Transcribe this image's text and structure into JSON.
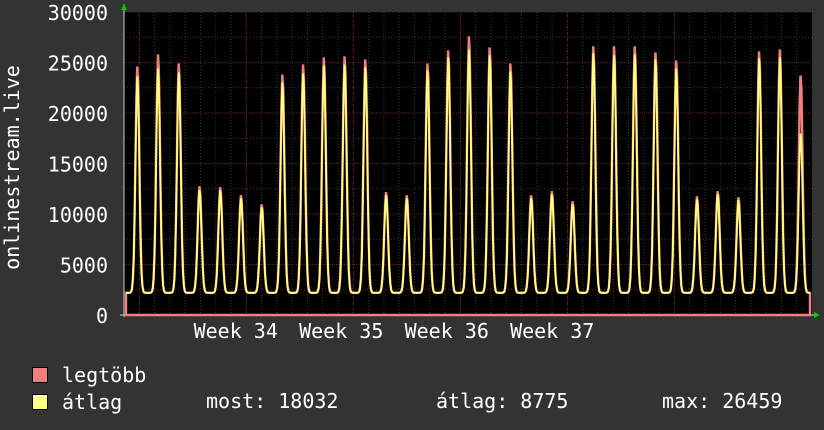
{
  "chart_data": {
    "type": "area",
    "ylabel": "onlinestream.live",
    "ylim": [
      0,
      30000
    ],
    "y_ticks": [
      0,
      5000,
      10000,
      15000,
      20000,
      25000,
      30000
    ],
    "x_ticks": [
      "Week 34",
      "Week 35",
      "Week 36",
      "Week 37"
    ],
    "grid": true,
    "colors": {
      "background": "#333333",
      "plot_background": "#000000",
      "grid": "#3a3a3a",
      "grid_major": "#5a2020",
      "legtobb": "#f08080",
      "atlag": "#ffff80"
    },
    "x": [
      1,
      2,
      3,
      4,
      5,
      6,
      7,
      8,
      9,
      10,
      11,
      12,
      13,
      14,
      15,
      16,
      17,
      18,
      19,
      20,
      21,
      22,
      23,
      24,
      25,
      26,
      27,
      28,
      29,
      30,
      31,
      32,
      33,
      34,
      35,
      36,
      37,
      38,
      39,
      40,
      41,
      42,
      43,
      44,
      45
    ],
    "series": [
      {
        "name": "legtöbb",
        "values": [
          24700,
          25900,
          25000,
          12800,
          12700,
          11900,
          11000,
          23900,
          24900,
          25600,
          25700,
          25400,
          12200,
          11900,
          25000,
          26300,
          27700,
          26600,
          25000,
          11900,
          12300,
          11300,
          26700,
          26700,
          26700,
          26100,
          25300,
          11800,
          12300,
          11700,
          26200,
          26400,
          23800,
          null,
          null,
          null,
          null,
          null,
          null,
          null,
          null,
          null,
          null,
          null,
          null
        ]
      },
      {
        "name": "átlag",
        "values": [
          23700,
          24500,
          24100,
          12400,
          12400,
          11600,
          10700,
          23100,
          24000,
          24800,
          24900,
          24600,
          11900,
          11600,
          24300,
          25600,
          26400,
          25800,
          24200,
          11600,
          12000,
          11000,
          26000,
          25800,
          25900,
          25400,
          24500,
          11500,
          12000,
          11400,
          25500,
          25600,
          18032,
          null,
          null,
          null,
          null,
          null,
          null,
          null,
          null,
          null,
          null,
          null,
          null
        ]
      }
    ],
    "legend": [
      {
        "name": "legtöbb",
        "color": "#f08080"
      },
      {
        "name": "átlag",
        "color": "#ffff80"
      }
    ],
    "stats": {
      "most_label": "most:",
      "most_value": "18032",
      "atlag_label": "átlag:",
      "atlag_value": "8775",
      "max_label": "max:",
      "max_value": "26459"
    }
  }
}
